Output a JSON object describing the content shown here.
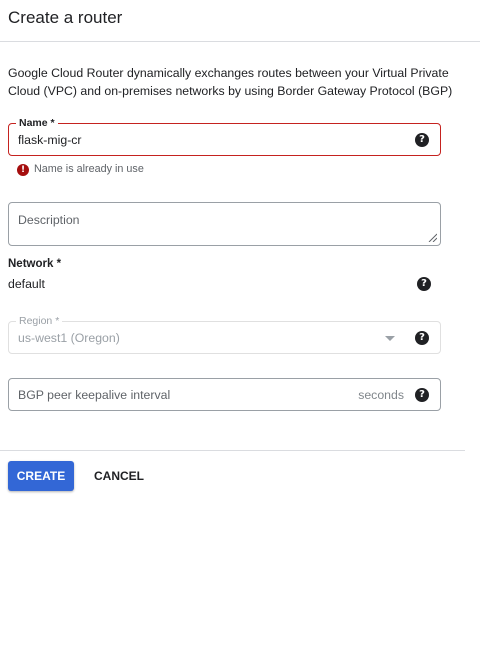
{
  "header": {
    "title": "Create a router"
  },
  "intro": "Google Cloud Router dynamically exchanges routes between your Virtual Private Cloud (VPC) and on-premises networks by using Border Gateway Protocol (BGP)",
  "name_field": {
    "label": "Name *",
    "value": "flask-mig-cr",
    "error": "Name is already in use"
  },
  "description_field": {
    "placeholder": "Description"
  },
  "network": {
    "label": "Network *",
    "value": "default"
  },
  "region_field": {
    "label": "Region *",
    "value": "us-west1 (Oregon)"
  },
  "bgp_field": {
    "placeholder": "BGP peer keepalive interval",
    "suffix": "seconds"
  },
  "buttons": {
    "create": "CREATE",
    "cancel": "CANCEL"
  },
  "icons": {
    "help": "help-icon",
    "error": "error-icon"
  },
  "colors": {
    "primary": "#3367d6",
    "error": "#c5221f"
  }
}
